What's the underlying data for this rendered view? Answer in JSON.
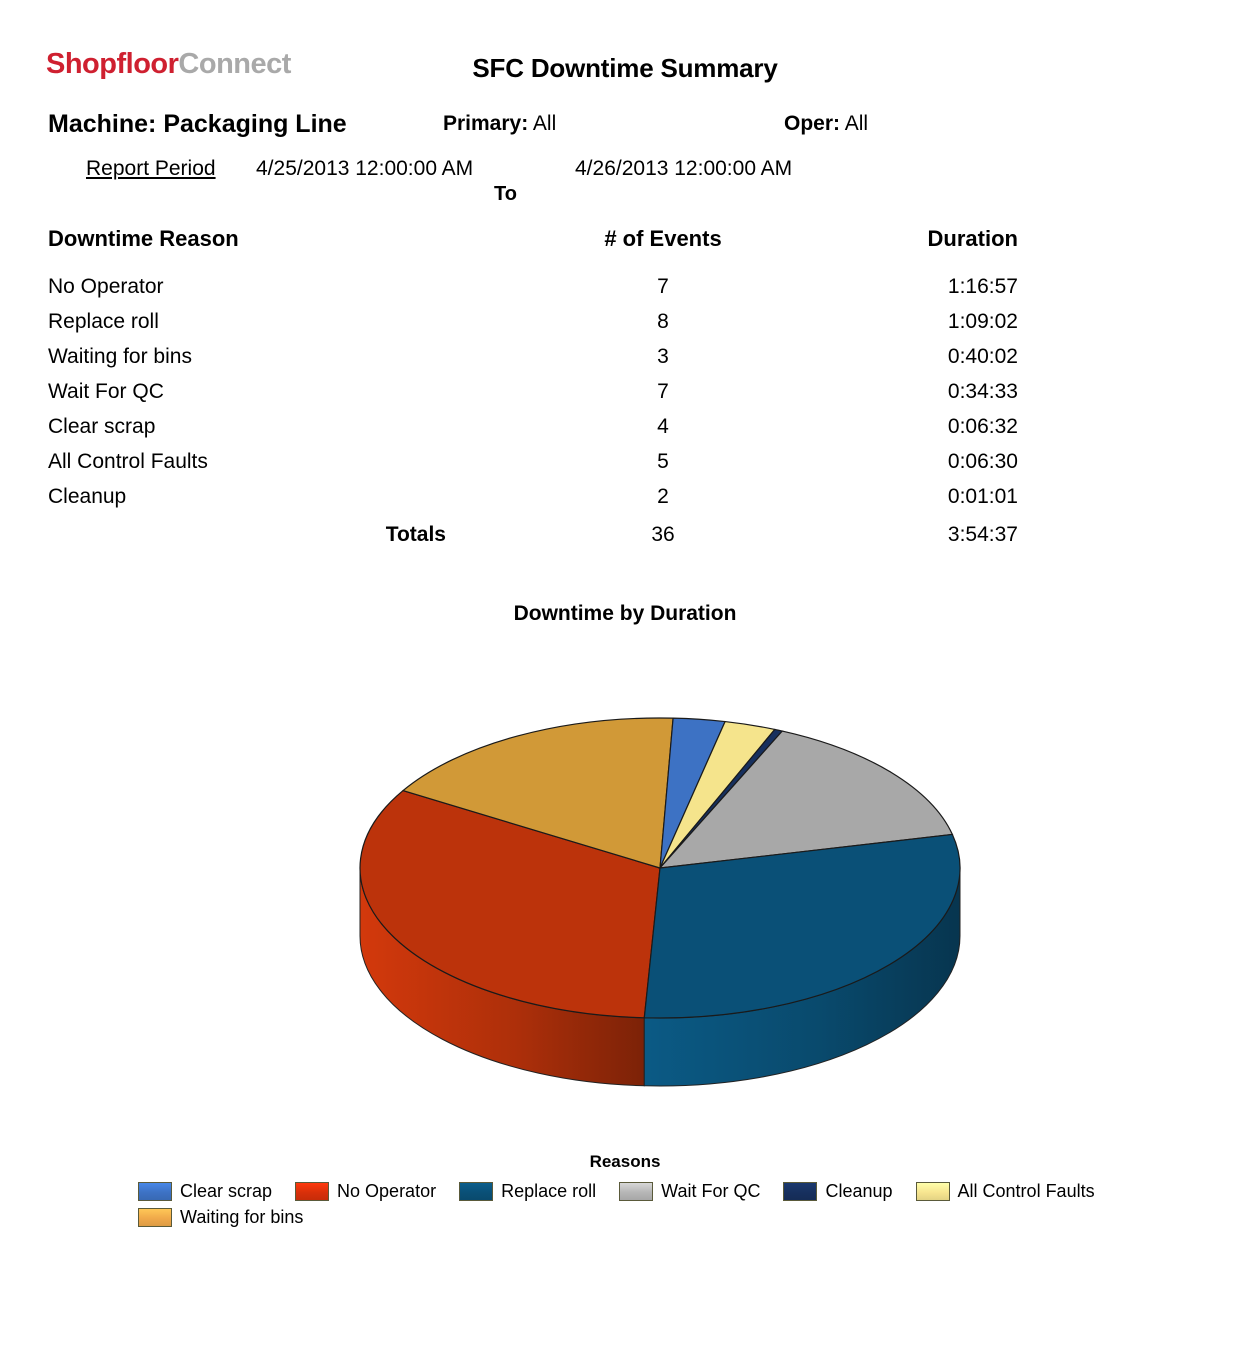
{
  "brand": {
    "part1": "Shopfloor",
    "part2": "Connect",
    "color1": "#cf2030",
    "color2": "#a9a9a9"
  },
  "header": {
    "title": "SFC Downtime Summary",
    "machine_label": "Machine:",
    "machine_value": "Packaging Line",
    "primary_label": "Primary:",
    "primary_value": "All",
    "oper_label": "Oper:",
    "oper_value": "All",
    "period_label": "Report Period",
    "period_from": "4/25/2013 12:00:00 AM",
    "period_to": "4/26/2013 12:00:00 AM",
    "period_to_word": "To"
  },
  "table": {
    "columns": [
      "Downtime Reason",
      "# of Events",
      "Duration"
    ],
    "rows": [
      {
        "reason": "No Operator",
        "events": "7",
        "duration": "1:16:57"
      },
      {
        "reason": "Replace roll",
        "events": "8",
        "duration": "1:09:02"
      },
      {
        "reason": "Waiting for bins",
        "events": "3",
        "duration": "0:40:02"
      },
      {
        "reason": "Wait For QC",
        "events": "7",
        "duration": "0:34:33"
      },
      {
        "reason": "Clear scrap",
        "events": "4",
        "duration": "0:06:32"
      },
      {
        "reason": "All Control Faults",
        "events": "5",
        "duration": "0:06:30"
      },
      {
        "reason": "Cleanup",
        "events": "2",
        "duration": "0:01:01"
      }
    ],
    "totals": {
      "label": "Totals",
      "events": "36",
      "duration": "3:54:37"
    }
  },
  "chart_data": {
    "type": "pie",
    "title": "Downtime by Duration",
    "legend_title": "Reasons",
    "legend_position": "bottom",
    "value_unit": "seconds of downtime duration",
    "categories": [
      "No Operator",
      "Replace roll",
      "Waiting for bins",
      "Wait For QC",
      "Clear scrap",
      "All Control Faults",
      "Cleanup"
    ],
    "values": [
      4617,
      4142,
      2402,
      2073,
      392,
      390,
      61
    ],
    "durations": [
      "1:16:57",
      "1:09:02",
      "0:40:02",
      "0:34:33",
      "0:06:32",
      "0:06:30",
      "0:01:01"
    ],
    "percentages": [
      32.8,
      29.4,
      17.1,
      14.7,
      2.8,
      2.8,
      0.4
    ],
    "total": 14077,
    "total_duration": "3:54:37",
    "colors": [
      "#bc330b",
      "#0a5077",
      "#d19937",
      "#a8a8a8",
      "#3d72c4",
      "#f5e48c",
      "#17305e"
    ],
    "legend_entries": [
      {
        "label": "Clear scrap",
        "color": "#3d72c4"
      },
      {
        "label": "No Operator",
        "color": "#d8300a"
      },
      {
        "label": "Replace roll",
        "color": "#0a5077"
      },
      {
        "label": "Wait For QC",
        "color": "#b6b6b6"
      },
      {
        "label": "Cleanup",
        "color": "#17305e"
      },
      {
        "label": "All Control Faults",
        "color": "#f7e590"
      },
      {
        "label": "Waiting for bins",
        "color": "#f0a94a"
      }
    ]
  }
}
